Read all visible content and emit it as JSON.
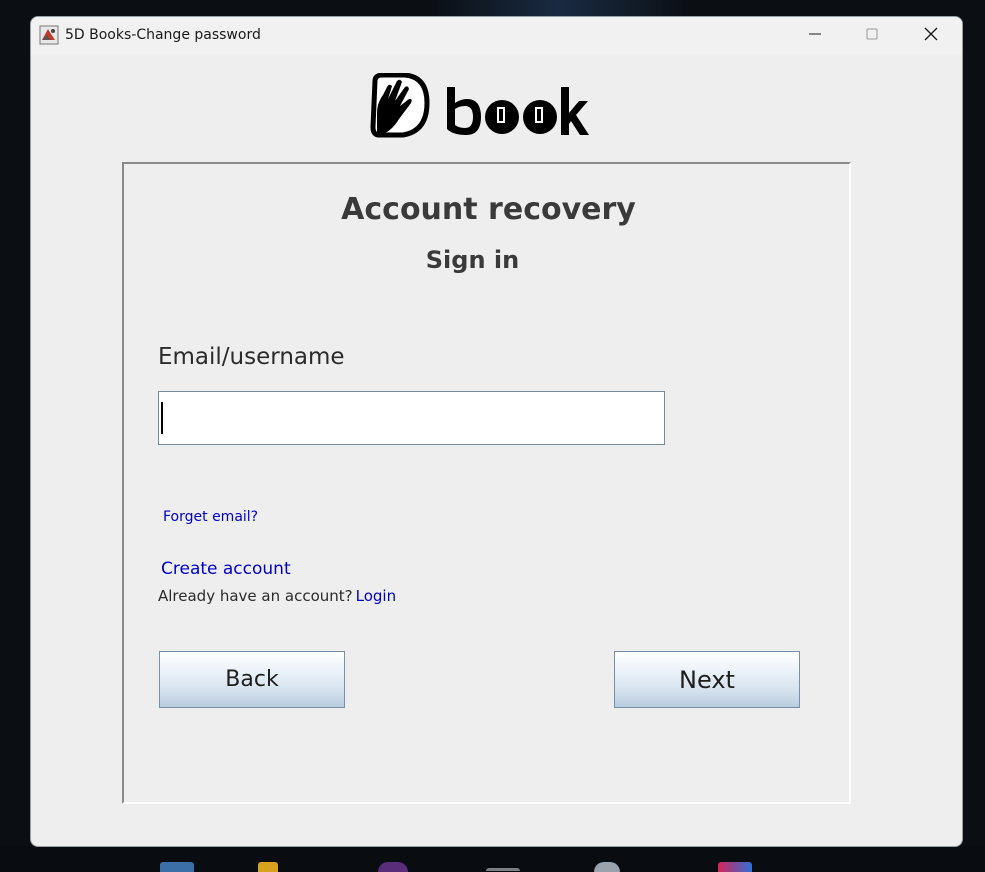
{
  "window": {
    "title": "5D Books-Change password",
    "controls": {
      "minimize": "minimize-icon",
      "maximize": "maximize-icon",
      "close": "close-icon"
    }
  },
  "logo": {
    "text": "book",
    "icon": "hand-icon"
  },
  "form": {
    "heading": "Account recovery",
    "subheading": "Sign in",
    "email_label": "Email/username",
    "email_value": "",
    "email_placeholder": "",
    "forget_email_link": "Forget email?",
    "create_account_link": "Create account",
    "have_account_text": "Already have an account?",
    "login_link": "Login",
    "back_button": "Back",
    "next_button": "Next"
  },
  "colors": {
    "link": "#0000cc",
    "window_bg": "#eeeeee",
    "heading": "#3a3a3a"
  }
}
